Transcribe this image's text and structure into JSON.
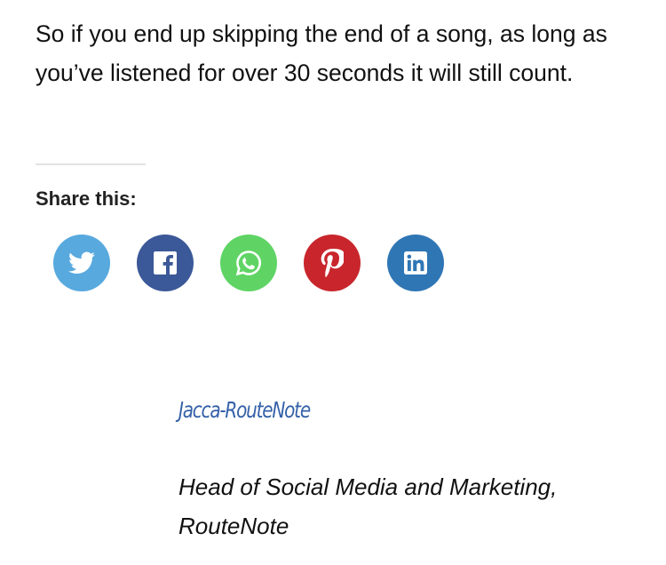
{
  "article": {
    "paragraph": "So if you end up skipping the end of a song, as long as you’ve listened for over 30 seconds it will still count."
  },
  "share": {
    "heading": "Share this:",
    "buttons": [
      {
        "network": "twitter",
        "icon": "twitter-bird-icon",
        "color": "#58a9de"
      },
      {
        "network": "facebook",
        "icon": "facebook-f-icon",
        "color": "#3b5998"
      },
      {
        "network": "whatsapp",
        "icon": "whatsapp-phone-icon",
        "color": "#5fd465"
      },
      {
        "network": "pinterest",
        "icon": "pinterest-p-icon",
        "color": "#c8262c"
      },
      {
        "network": "linkedin",
        "icon": "linkedin-in-icon",
        "color": "#2f76b5"
      }
    ]
  },
  "author": {
    "name": "Jacca-RouteNote",
    "role": "Head of Social Media and Marketing, RouteNote",
    "name_color": "#3461a8"
  }
}
